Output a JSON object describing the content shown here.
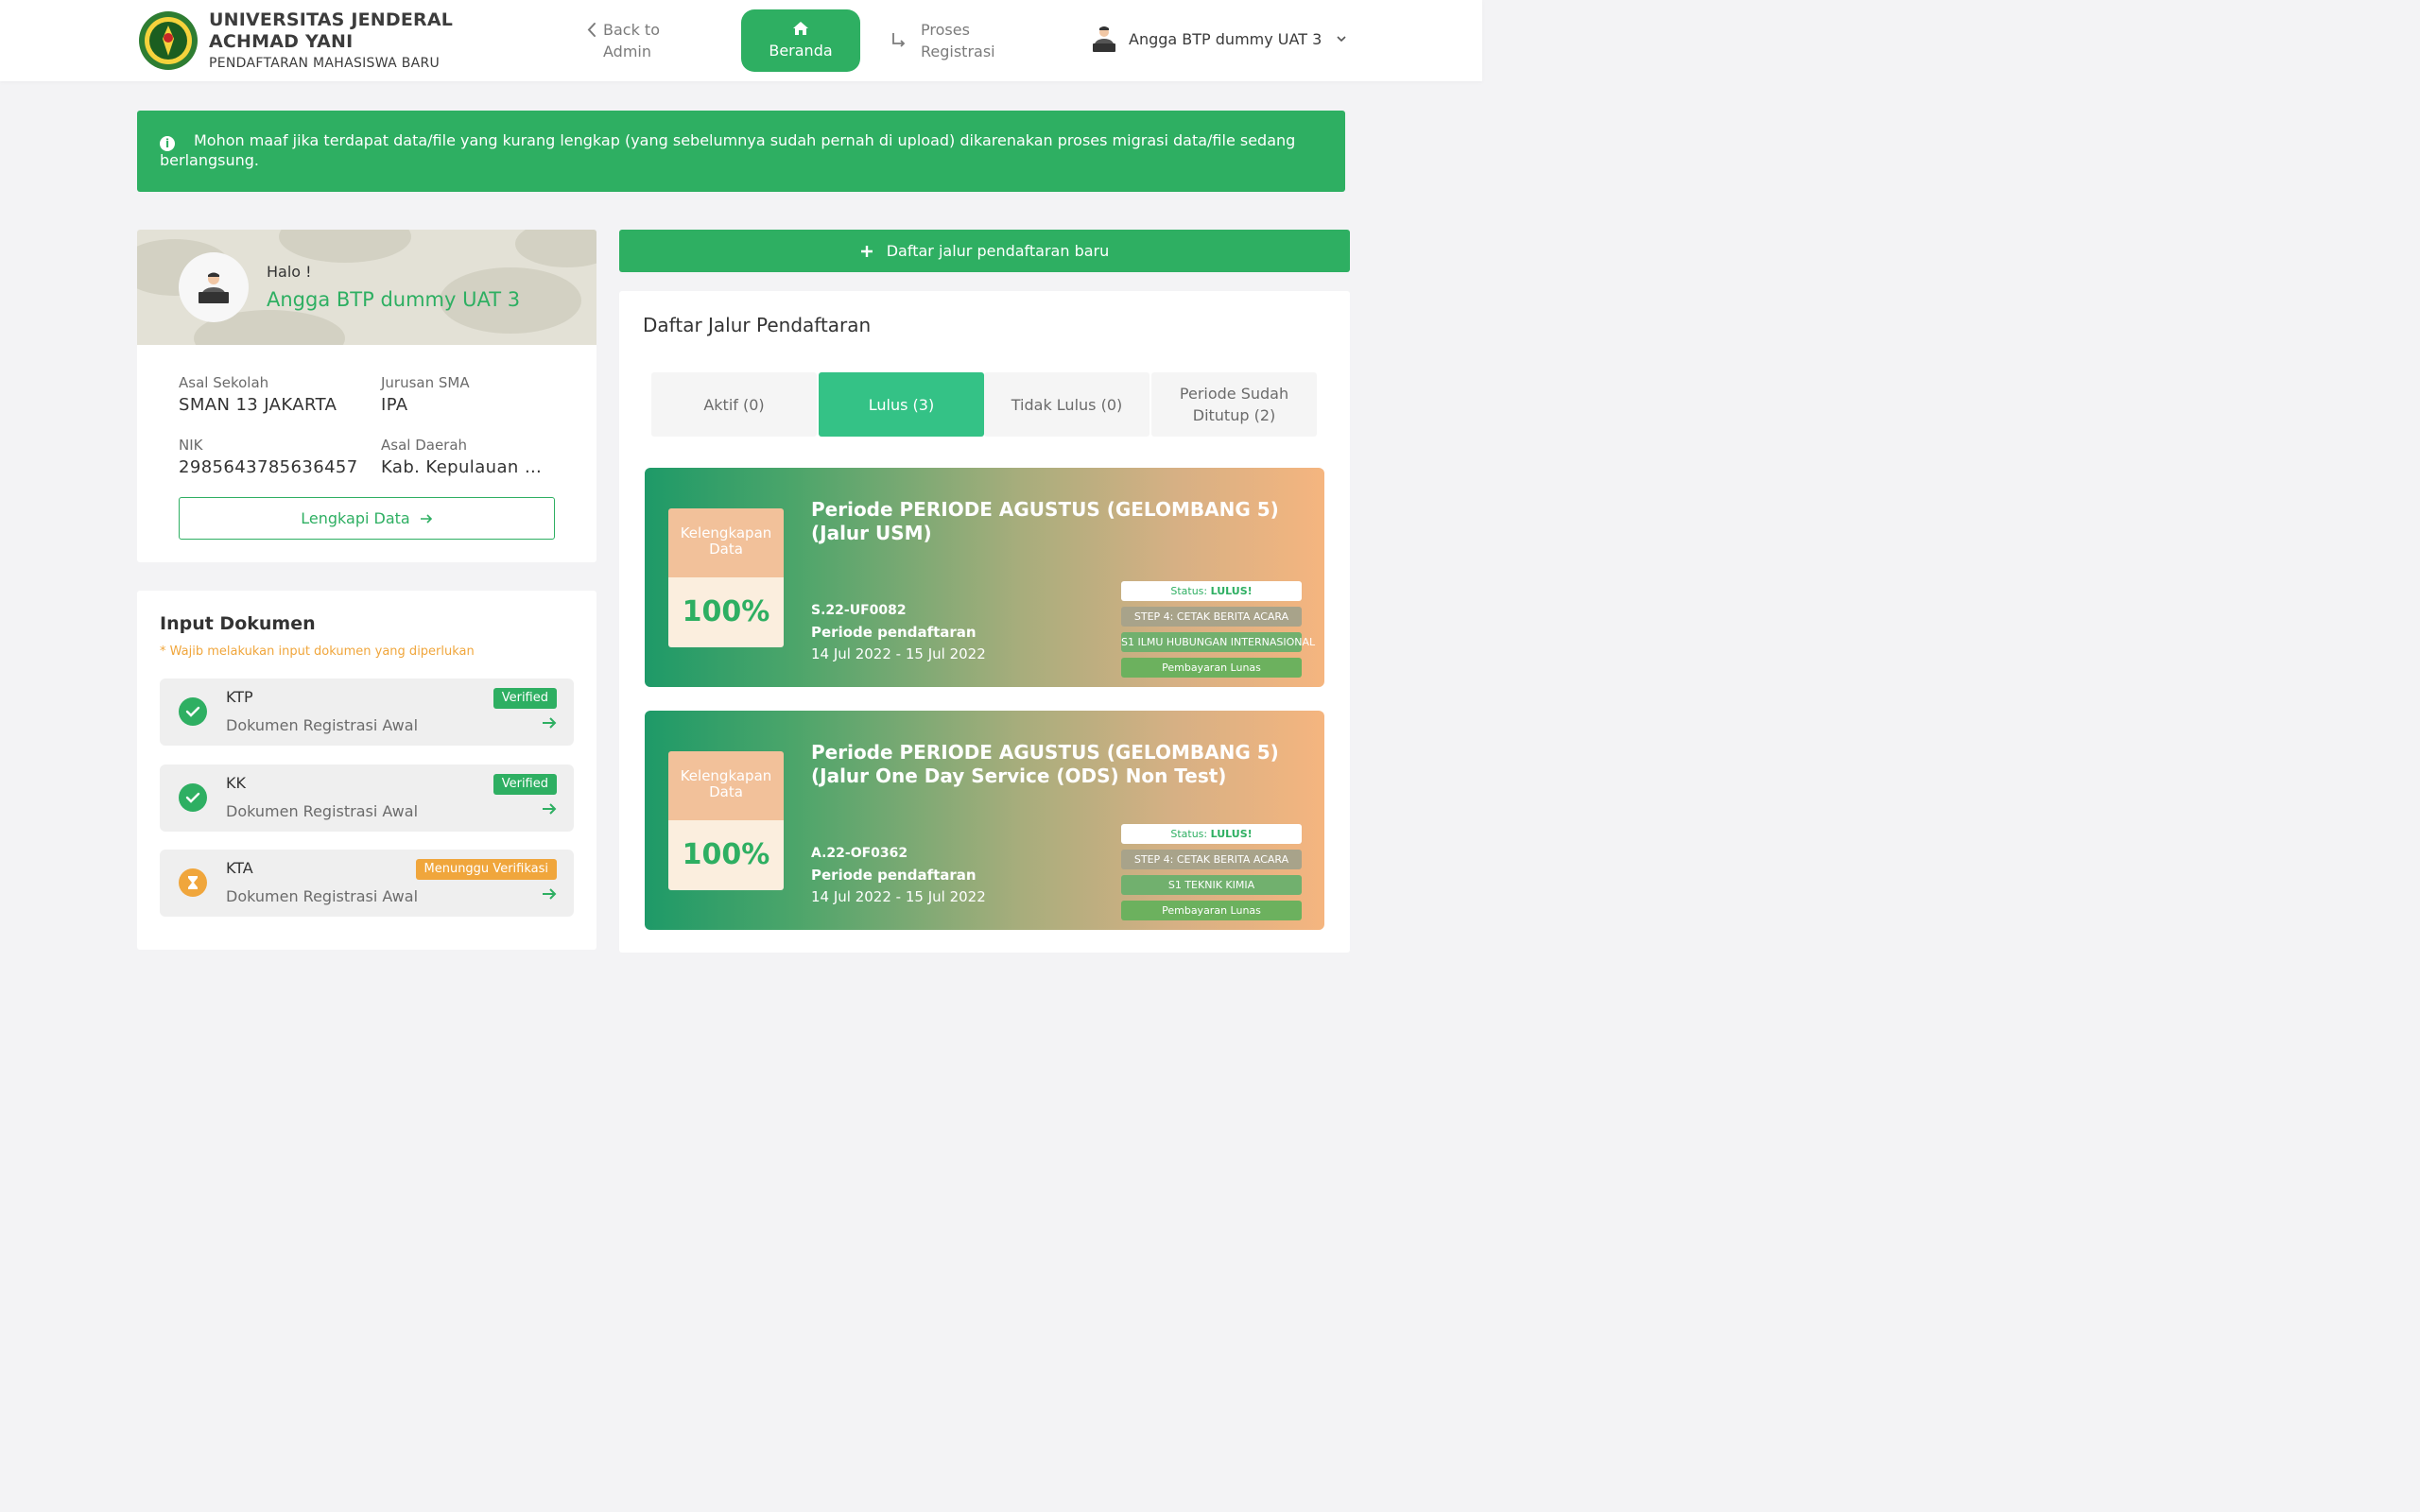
{
  "header": {
    "university_name": "UNIVERSITAS JENDERAL ACHMAD YANI",
    "subtitle": "PENDAFTARAN MAHASISWA BARU",
    "back_label": "Back to Admin",
    "home_label": "Beranda",
    "proses_label": "Proses Registrasi",
    "user_name": "Angga BTP dummy UAT 3",
    "accent_color": "#2eaf62"
  },
  "alert": {
    "message": "Mohon maaf jika terdapat data/file yang kurang lengkap (yang sebelumnya sudah pernah di upload) dikarenakan proses migrasi data/file sedang berlangsung."
  },
  "profile": {
    "greeting": "Halo !",
    "name": "Angga BTP dummy UAT 3",
    "fields": {
      "asal_sekolah_label": "Asal Sekolah",
      "asal_sekolah": "SMAN 13 JAKARTA",
      "jurusan_label": "Jurusan SMA",
      "jurusan": "IPA",
      "nik_label": "NIK",
      "nik": "2985643785636457",
      "asal_daerah_label": "Asal Daerah",
      "asal_daerah": "Kab. Kepulauan Seribu"
    },
    "complete_button": "Lengkapi Data"
  },
  "documents": {
    "title": "Input Dokumen",
    "note": "* Wajib melakukan input dokumen yang diperlukan",
    "items": [
      {
        "name": "KTP",
        "subtitle": "Dokumen Registrasi Awal",
        "badge": "Verified",
        "status": "verified"
      },
      {
        "name": "KK",
        "subtitle": "Dokumen Registrasi Awal",
        "badge": "Verified",
        "status": "verified"
      },
      {
        "name": "KTA",
        "subtitle": "Dokumen Registrasi Awal",
        "badge": "Menunggu Verifikasi",
        "status": "pending"
      }
    ]
  },
  "registration": {
    "new_button": "Daftar jalur pendaftaran baru",
    "list_title": "Daftar Jalur Pendaftaran",
    "tabs": [
      {
        "label": "Aktif (0)",
        "active": false
      },
      {
        "label": "Lulus (3)",
        "active": true
      },
      {
        "label": "Tidak Lulus (0)",
        "active": false
      },
      {
        "label": "Periode Sudah Ditutup (2)",
        "active": false
      }
    ],
    "periods": [
      {
        "title": "Periode PERIODE AGUSTUS (GELOMBANG 5) (Jalur USM)",
        "kelengkapan_label": "Kelengkapan Data",
        "kelengkapan_value": "100%",
        "code": "S.22-UF0082",
        "period_label": "Periode pendaftaran",
        "dates": "14 Jul 2022 - 15 Jul 2022",
        "status_prefix": "Status:",
        "status_value": "LULUS!",
        "step": "STEP 4: CETAK BERITA ACARA",
        "prodi": "S1 ILMU HUBUNGAN INTERNASIONAL",
        "payment": "Pembayaran Lunas"
      },
      {
        "title": "Periode PERIODE AGUSTUS (GELOMBANG 5) (Jalur One Day Service (ODS) Non Test)",
        "kelengkapan_label": "Kelengkapan Data",
        "kelengkapan_value": "100%",
        "code": "A.22-OF0362",
        "period_label": "Periode pendaftaran",
        "dates": "14 Jul 2022 - 15 Jul 2022",
        "status_prefix": "Status:",
        "status_value": "LULUS!",
        "step": "STEP 4: CETAK BERITA ACARA",
        "prodi": "S1 TEKNIK KIMIA",
        "payment": "Pembayaran Lunas"
      }
    ]
  }
}
